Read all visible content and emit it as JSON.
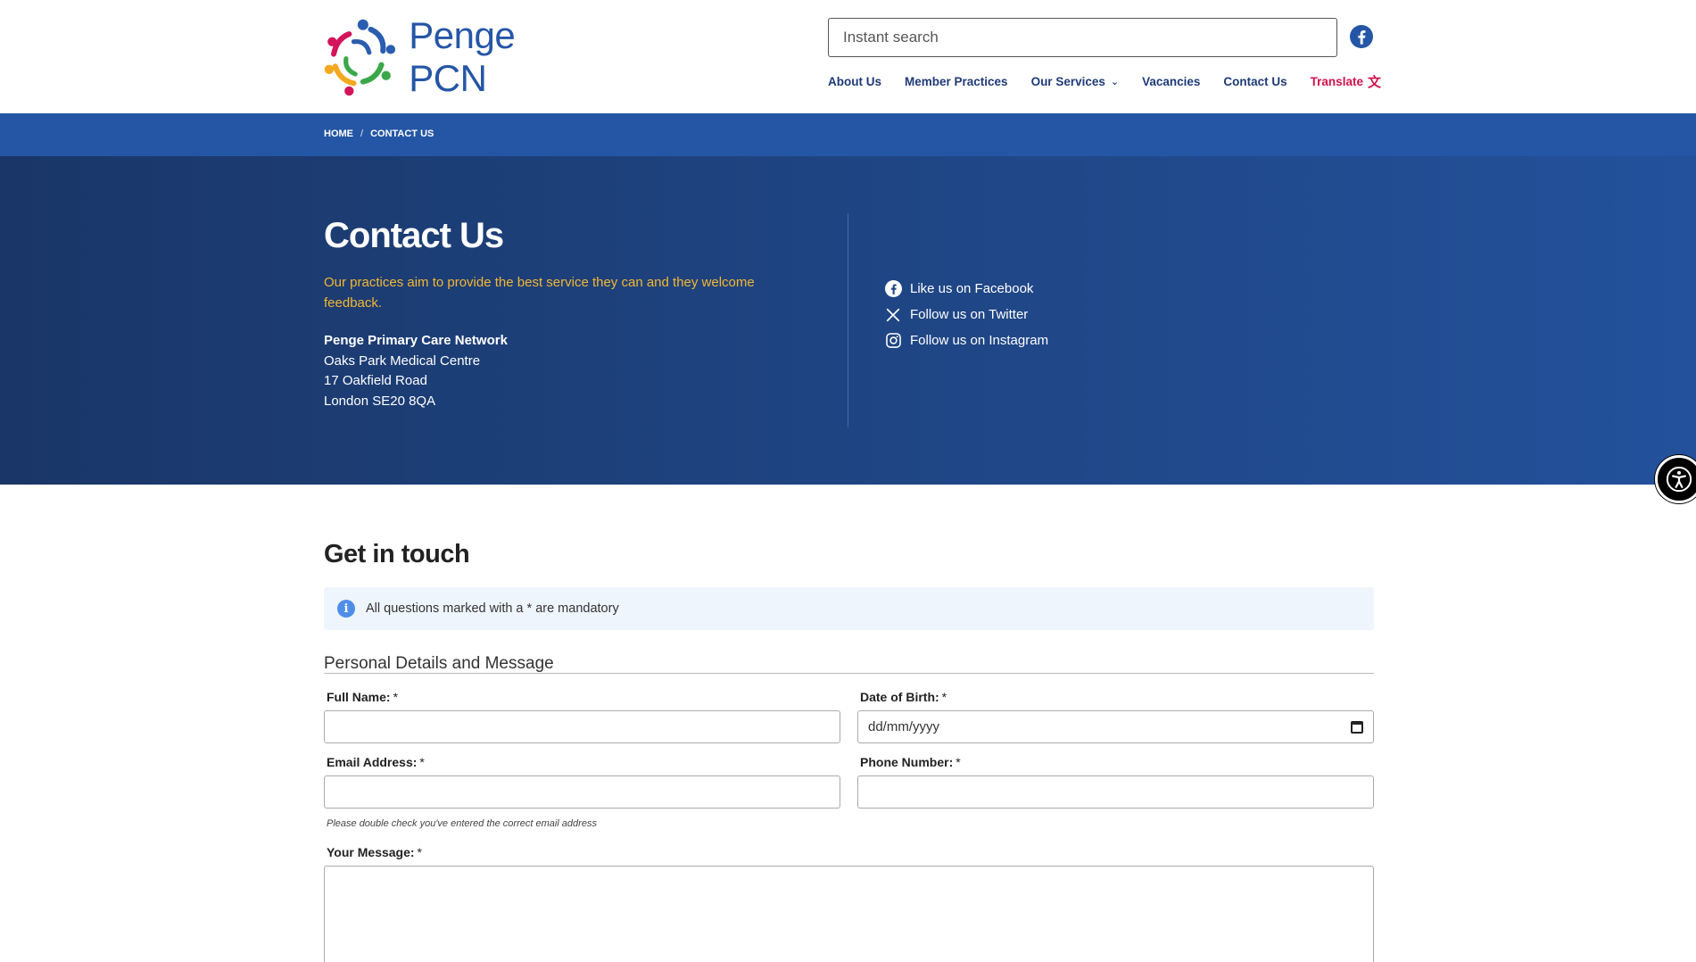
{
  "header": {
    "logo_text": "Penge PCN",
    "search_placeholder": "Instant search",
    "nav": [
      {
        "label": "About Us"
      },
      {
        "label": "Member Practices"
      },
      {
        "label": "Our Services"
      },
      {
        "label": "Vacancies"
      },
      {
        "label": "Contact Us"
      }
    ],
    "translate_label": "Translate"
  },
  "breadcrumb": {
    "home": "HOME",
    "separator": "/",
    "current": "CONTACT US"
  },
  "hero": {
    "title": "Contact Us",
    "lead": "Our practices aim to provide the best service they can and they welcome feedback.",
    "address": {
      "org": "Penge Primary Care Network",
      "line1": "Oaks Park Medical Centre",
      "line2": "17 Oakfield Road",
      "line3": "London SE20 8QA"
    },
    "social": [
      {
        "icon": "facebook-icon",
        "label": "Like us on Facebook"
      },
      {
        "icon": "x-twitter-icon",
        "label": "Follow us on Twitter"
      },
      {
        "icon": "instagram-icon",
        "label": "Follow us on Instagram"
      }
    ]
  },
  "form": {
    "title": "Get in touch",
    "notice": "All questions marked with a * are mandatory",
    "legend": "Personal Details and Message",
    "required_mark": "*",
    "fields": {
      "full_name": {
        "label": "Full Name:",
        "value": ""
      },
      "dob": {
        "label": "Date of Birth:",
        "placeholder": "dd/mm/yyyy"
      },
      "email": {
        "label": "Email Address:",
        "value": "",
        "hint": "Please double check you've entered the correct email address"
      },
      "phone": {
        "label": "Phone Number:",
        "value": ""
      },
      "message": {
        "label": "Your Message:",
        "value": ""
      }
    }
  },
  "colors": {
    "brand_blue": "#2556a6",
    "breadcrumb_bar": "#2456a5",
    "hero_dark": "#1a3668",
    "accent_yellow": "#f4b731",
    "translate_red": "#d0104c",
    "notice_bg": "#eef5fd"
  }
}
